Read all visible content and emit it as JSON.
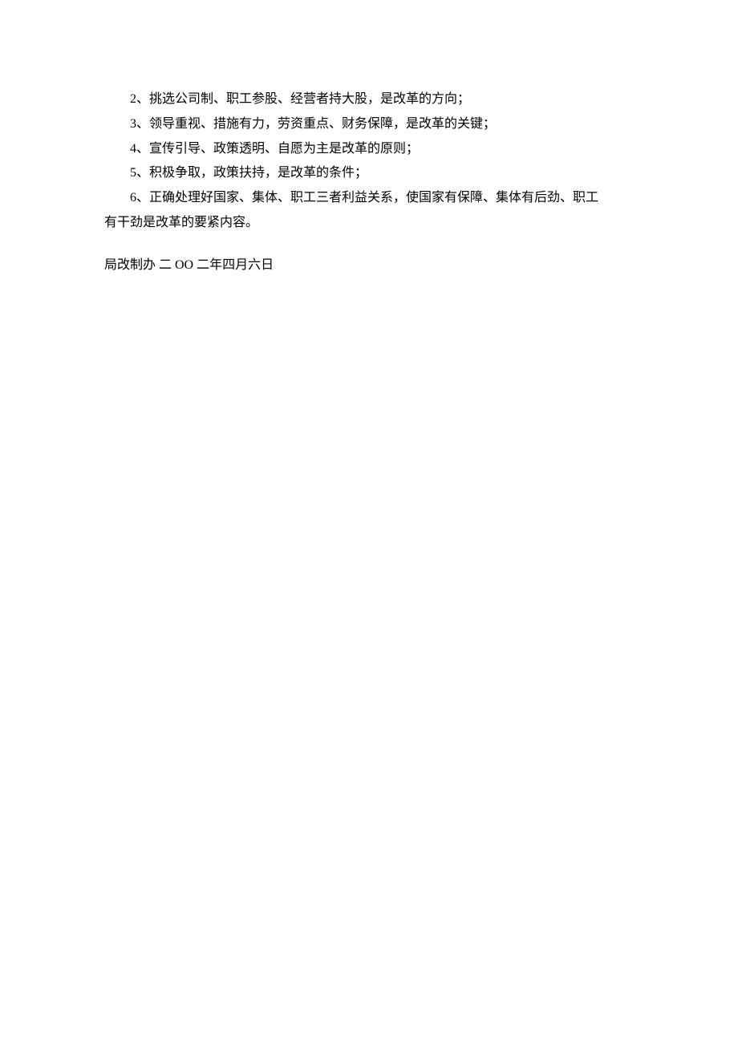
{
  "lines": {
    "item2": "2、挑选公司制、职工参股、经营者持大股，是改革的方向；",
    "item3": "3、领导重视、措施有力，劳资重点、财务保障，是改革的关键；",
    "item4": "4、宣传引导、政策透明、自愿为主是改革的原则；",
    "item5": "5、积极争取，政策扶持，是改革的条件；",
    "item6_part1": "6、正确处理好国家、集体、职工三者利益关系，使国家有保障、集体有后劲、职工",
    "item6_part2": "有干劲是改革的要紧内容。"
  },
  "signature": "局改制办   二 OO 二年四月六日"
}
